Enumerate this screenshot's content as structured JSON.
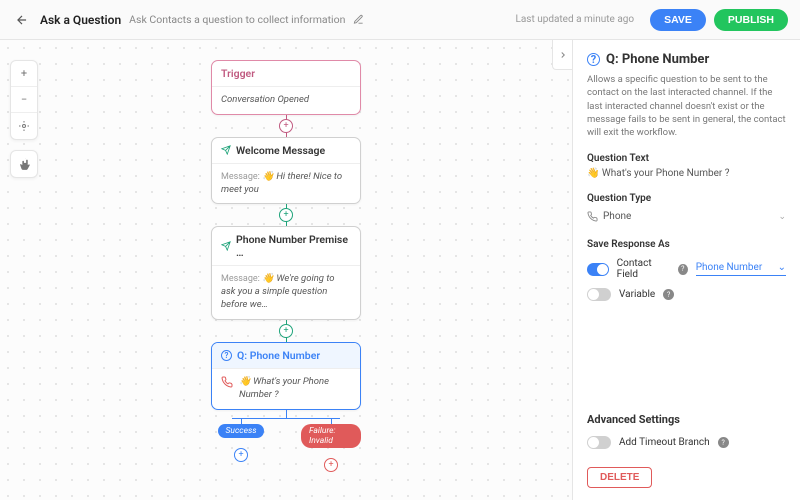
{
  "header": {
    "title": "Ask a Question",
    "subtitle": "Ask Contacts a question to collect information",
    "last_updated": "Last updated a minute ago",
    "save": "SAVE",
    "publish": "PUBLISH"
  },
  "flow": {
    "trigger": {
      "label": "Trigger",
      "body": "Conversation Opened"
    },
    "welcome": {
      "label": "Welcome Message",
      "prefix": "Message:",
      "body": "👋 Hi there! Nice to meet you"
    },
    "premise": {
      "label": "Phone Number Premise …",
      "prefix": "Message:",
      "body": "👋 We're going to ask you a simple question before we…"
    },
    "question": {
      "label": "Q: Phone Number",
      "body": "👋 What's your Phone Number ?"
    },
    "branch_success": "Success",
    "branch_failure": "Failure: Invalid"
  },
  "panel": {
    "title": "Q: Phone Number",
    "desc": "Allows a specific question to be sent to the contact on the last interacted channel. If the last interacted channel doesn't exist or the message fails to be sent in general, the contact will exit the workflow.",
    "question_text_label": "Question Text",
    "question_text_value": "👋 What's your Phone Number ?",
    "question_type_label": "Question Type",
    "question_type_value": "Phone",
    "save_response_label": "Save Response As",
    "contact_field_label": "Contact Field",
    "contact_field_value": "Phone Number",
    "variable_label": "Variable",
    "advanced_label": "Advanced Settings",
    "timeout_label": "Add Timeout Branch",
    "delete": "DELETE"
  }
}
